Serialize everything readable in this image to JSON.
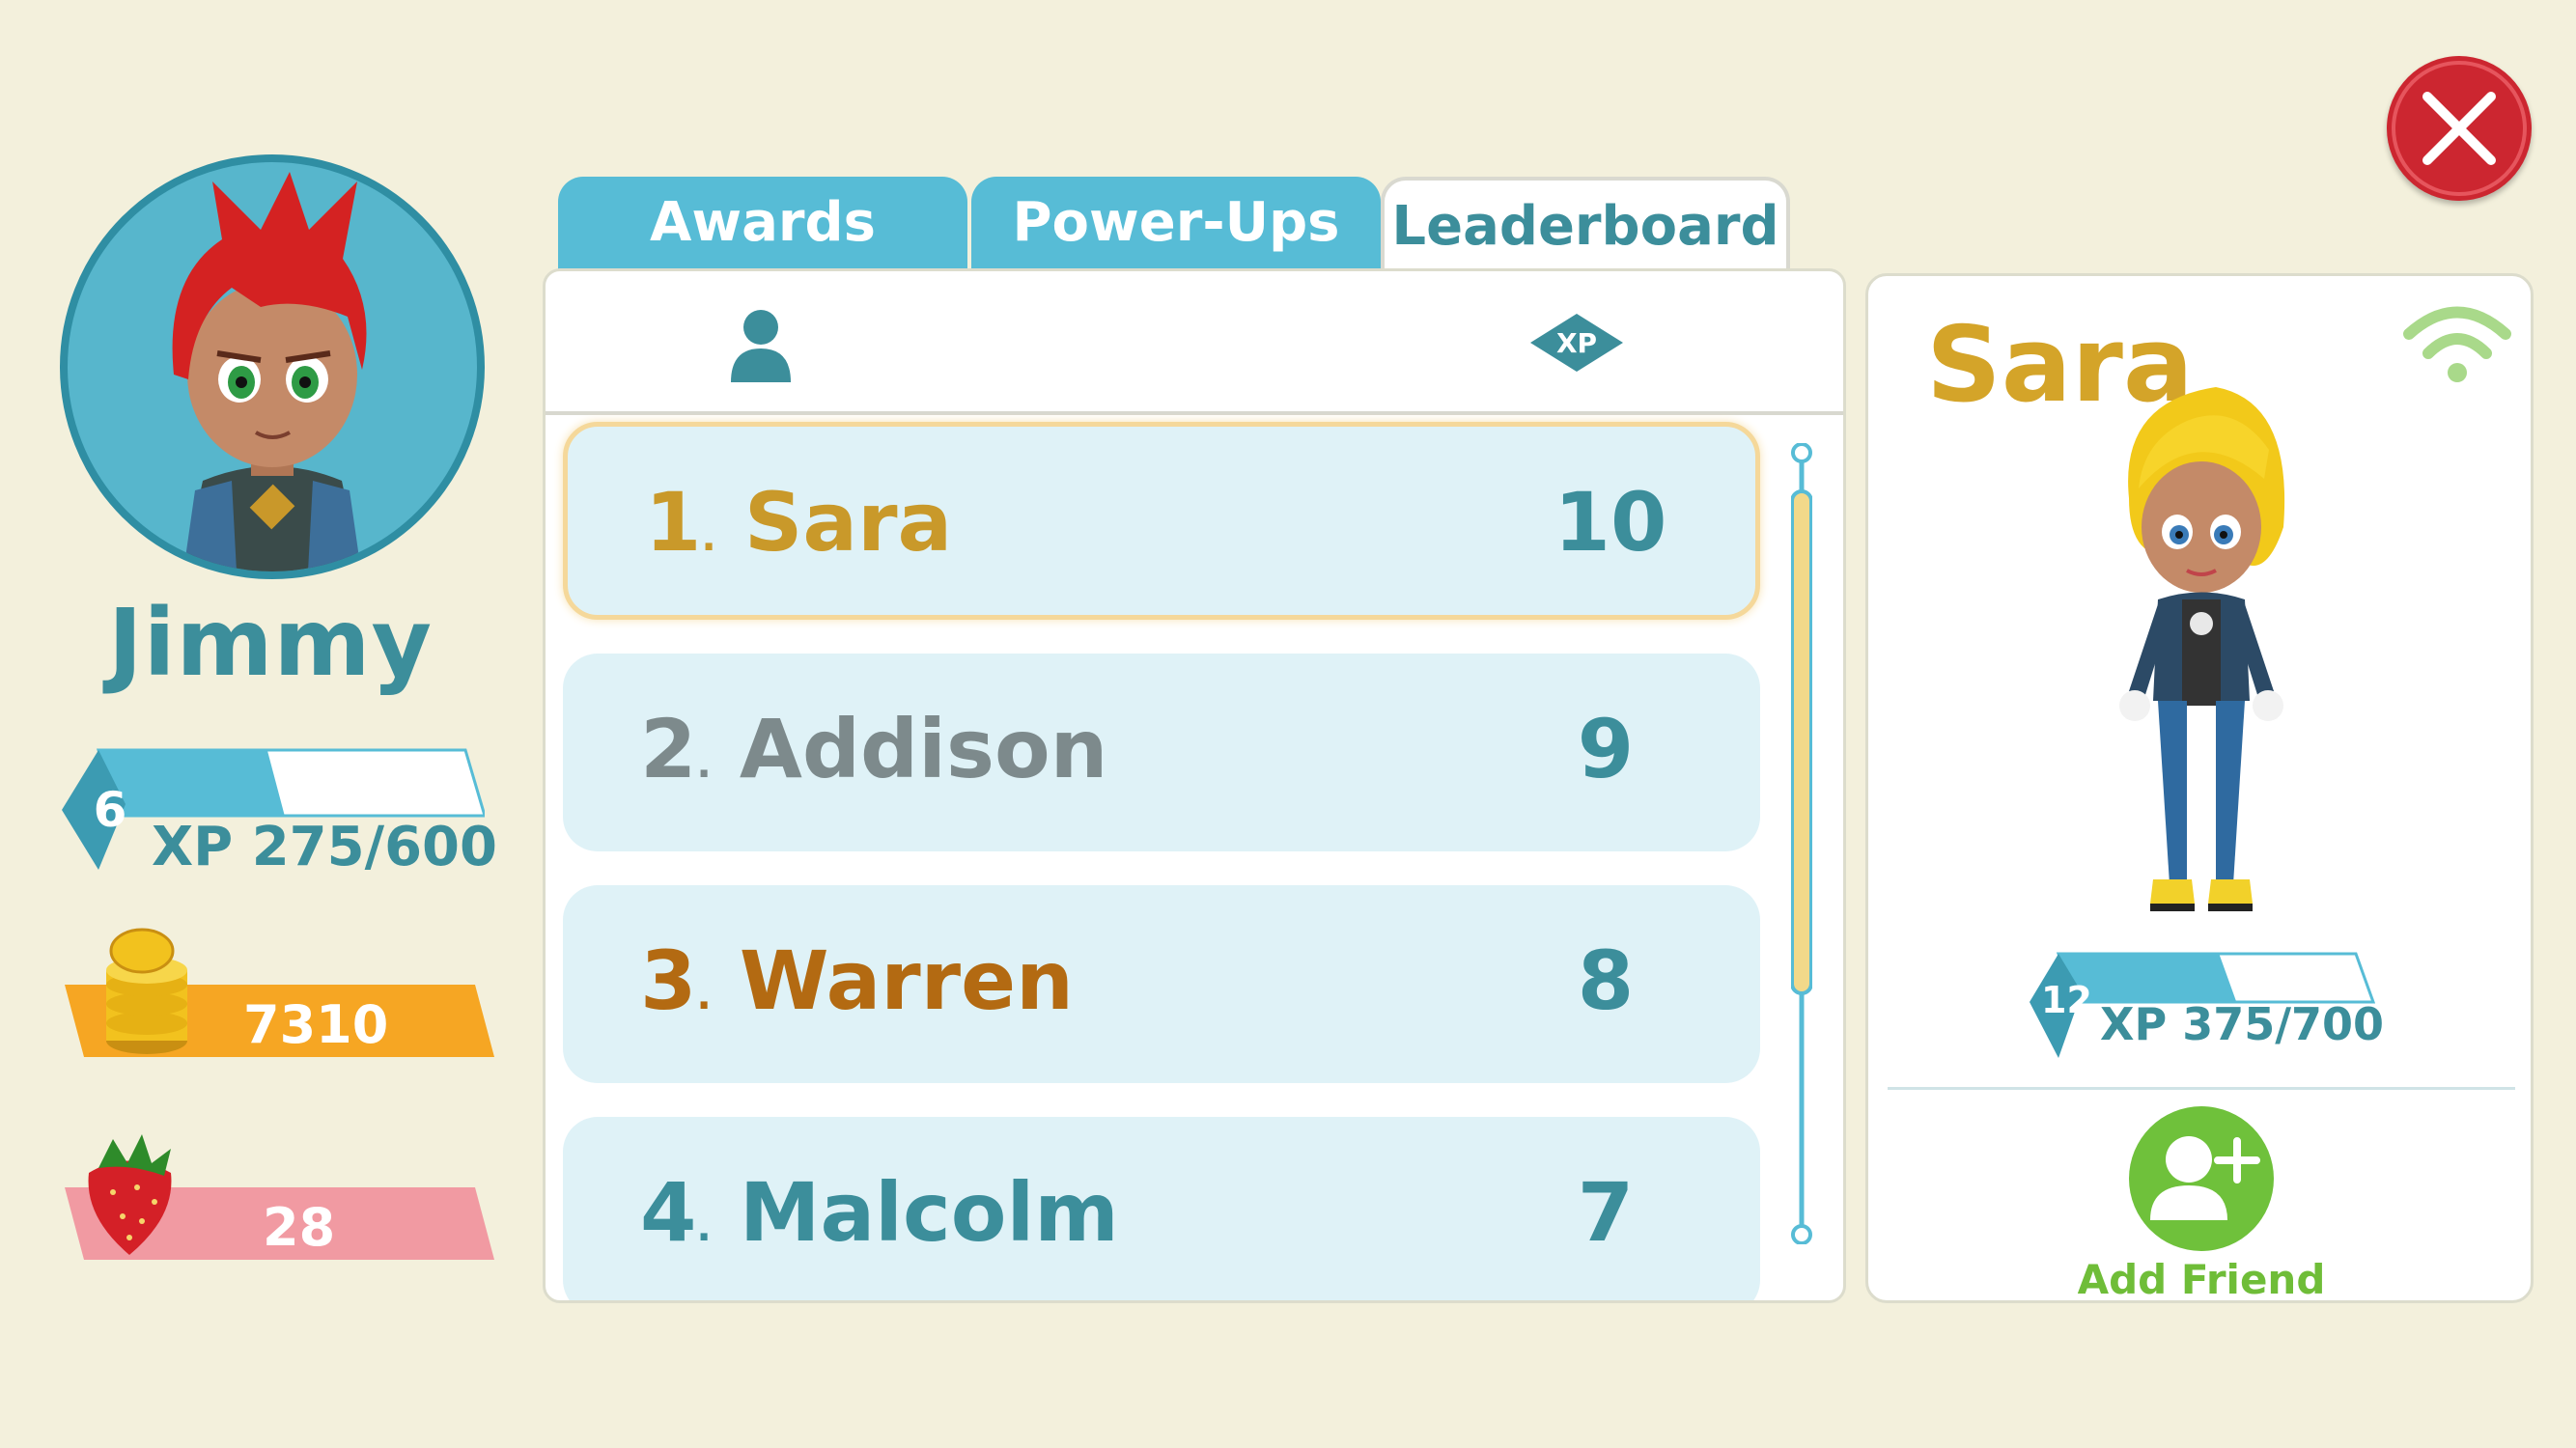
{
  "player": {
    "name": "Jimmy",
    "level": "6",
    "xp_text": "XP 275/600",
    "xp_progress": 0.46,
    "coins": "7310",
    "strawberries": "28"
  },
  "tabs": [
    {
      "label": "Awards",
      "active": false
    },
    {
      "label": "Power-Ups",
      "active": false
    },
    {
      "label": "Leaderboard",
      "active": true
    }
  ],
  "leaderboard": {
    "header_icons": [
      "person-icon",
      "xp-icon"
    ],
    "xp_badge": "XP",
    "rows": [
      {
        "rank": "1",
        "name": "Sara",
        "score": "10",
        "color": "#c9992a",
        "selected": true
      },
      {
        "rank": "2",
        "name": "Addison",
        "score": "9",
        "color": "#7d8a8c",
        "selected": false
      },
      {
        "rank": "3",
        "name": "Warren",
        "score": "8",
        "color": "#b36a12",
        "selected": false
      },
      {
        "rank": "4",
        "name": "Malcolm",
        "score": "7",
        "color": "#3c8e9b",
        "selected": false
      }
    ]
  },
  "profile": {
    "name": "Sara",
    "level": "12",
    "xp_text": "XP 375/700",
    "xp_progress": 0.54,
    "add_friend_label": "Add Friend",
    "online_icon": "wifi-icon"
  },
  "colors": {
    "background": "#f3f0dc",
    "teal": "#3c8e9b",
    "tab_blue": "#57bcd6",
    "gold": "#d4a429",
    "close_red": "#cc2630",
    "friend_green": "#6fc13b"
  }
}
